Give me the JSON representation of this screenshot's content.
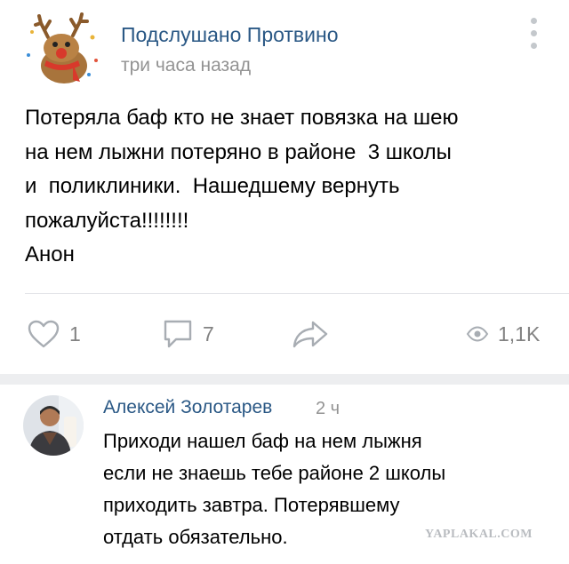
{
  "post": {
    "author": "Подслушано Протвино",
    "time": "три часа назад",
    "avatar_icon": "reindeer-icon",
    "text": "Потеряла баф кто не знает повязка на шею\nна нем лыжни потеряно в районе  3 школы\nи  поликлиники.  Нашедшему вернуть\nпожалуйста!!!!!!!!\nАнон",
    "likes": "1",
    "comments": "7",
    "views": "1,1K"
  },
  "comment": {
    "author": "Алексей Золотарев",
    "time": "2 ч",
    "text": "Приходи нашел баф на нем лыжня\nесли не знаешь тебе районе 2 школы\nприходить завтра. Потерявшему\nотдать обязательно."
  },
  "watermark": "YAPLAKAL.COM",
  "colors": {
    "link": "#2a5885",
    "secondary_text": "#939393",
    "icon_gray": "#828282",
    "separator": "#e3e4e8",
    "band": "#edeef0"
  }
}
